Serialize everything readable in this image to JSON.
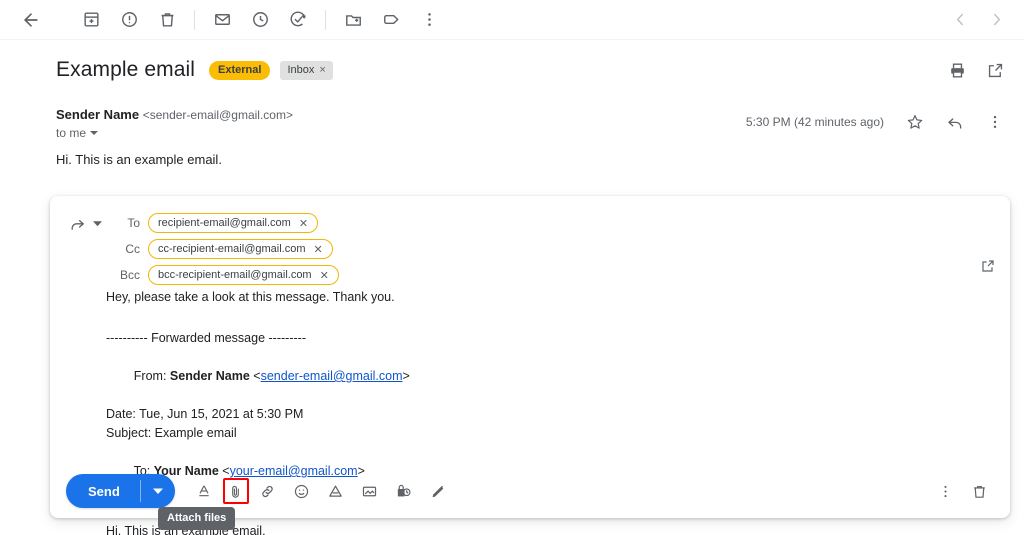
{
  "toolbar": {
    "back_label": "Back",
    "items": [
      {
        "name": "archive-icon",
        "label": "Archive"
      },
      {
        "name": "report-spam-icon",
        "label": "Report spam"
      },
      {
        "name": "delete-icon",
        "label": "Delete"
      },
      {
        "name": "mark-unread-icon",
        "label": "Mark as unread"
      },
      {
        "name": "snooze-icon",
        "label": "Snooze"
      },
      {
        "name": "add-to-tasks-icon",
        "label": "Add to Tasks"
      },
      {
        "name": "move-to-icon",
        "label": "Move to"
      },
      {
        "name": "labels-icon",
        "label": "Labels"
      },
      {
        "name": "more-options-icon",
        "label": "More"
      }
    ],
    "prev_label": "Newer",
    "next_label": "Older"
  },
  "email": {
    "subject": "Example email",
    "badge": "External",
    "label_chip": "Inbox",
    "label_chip_close": "×",
    "print_label": "Print all",
    "popout_label": "Open in new window",
    "sender_name": "Sender Name",
    "sender_email": "<sender-email@gmail.com>",
    "to_me": "to me",
    "timestamp": "5:30 PM (42 minutes ago)",
    "star_label": "Star",
    "reply_label": "Reply",
    "more_label": "More",
    "body": "Hi. This is an example email."
  },
  "compose": {
    "forward_label": "Forward",
    "recipients": [
      {
        "label": "To",
        "value": "recipient-email@gmail.com",
        "close": "✕"
      },
      {
        "label": "Cc",
        "value": "cc-recipient-email@gmail.com",
        "close": "✕"
      },
      {
        "label": "Bcc",
        "value": "bcc-recipient-email@gmail.com",
        "close": "✕"
      }
    ],
    "popout_label": "Full screen",
    "message": "Hey, please take a look at this message. Thank you.",
    "forwarded_divider": "---------- Forwarded message ---------",
    "from_label": "From: ",
    "from_name": "Sender Name",
    "from_email_open": " <",
    "from_email": "sender-email@gmail.com",
    "from_email_close": ">",
    "date_line": "Date: Tue, Jun 15, 2021 at 5:30 PM",
    "subject_line": "Subject: Example email",
    "to_label": "To: ",
    "to_name": "Your Name",
    "to_email_open": " <",
    "to_email": "your-email@gmail.com",
    "to_email_close": ">",
    "quoted_body": "Hi. This is an example email.",
    "send_label": "Send",
    "send_options_label": "More send options",
    "format_tools": [
      {
        "name": "formatting-options-icon",
        "label": "Formatting options"
      },
      {
        "name": "attach-files-icon",
        "label": "Attach files"
      },
      {
        "name": "insert-link-icon",
        "label": "Insert link"
      },
      {
        "name": "insert-emoji-icon",
        "label": "Insert emoji"
      },
      {
        "name": "insert-drive-file-icon",
        "label": "Insert files using Drive"
      },
      {
        "name": "insert-photo-icon",
        "label": "Insert photo"
      },
      {
        "name": "confidential-mode-icon",
        "label": "Toggle confidential mode"
      },
      {
        "name": "insert-signature-icon",
        "label": "Insert signature"
      }
    ],
    "more_options_label": "More options",
    "discard_label": "Discard draft"
  },
  "tooltip": {
    "text": "Attach files"
  },
  "colors": {
    "accent_blue": "#1a73e8",
    "badge_yellow": "#fbbc04",
    "chip_border": "#f2b705",
    "highlight_red": "#ff0000",
    "tooltip_bg": "#5f6368",
    "link_blue": "#1155cc"
  }
}
